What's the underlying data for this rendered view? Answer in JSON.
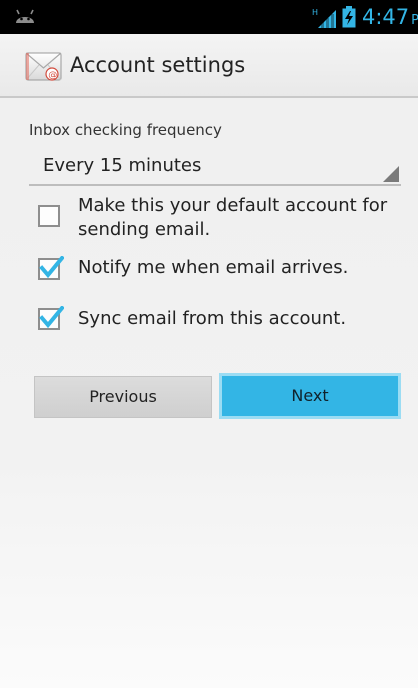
{
  "status_bar": {
    "time": "4:47",
    "ampm": "PM",
    "network_type": "H"
  },
  "action_bar": {
    "title": "Account settings"
  },
  "form": {
    "frequency_label": "Inbox checking frequency",
    "frequency_value": "Every 15 minutes",
    "options": [
      {
        "label": "Make this your default account for sending email.",
        "checked": false
      },
      {
        "label": "Notify me when email arrives.",
        "checked": true
      },
      {
        "label": "Sync email from this account.",
        "checked": true
      }
    ]
  },
  "buttons": {
    "previous": "Previous",
    "next": "Next"
  },
  "colors": {
    "accent": "#33b5e5",
    "status_bar_bg": "#000000"
  },
  "icons": {
    "status_left": "android-icon",
    "signal": "signal-icon",
    "battery": "battery-charging-icon",
    "app": "email-app-icon"
  }
}
